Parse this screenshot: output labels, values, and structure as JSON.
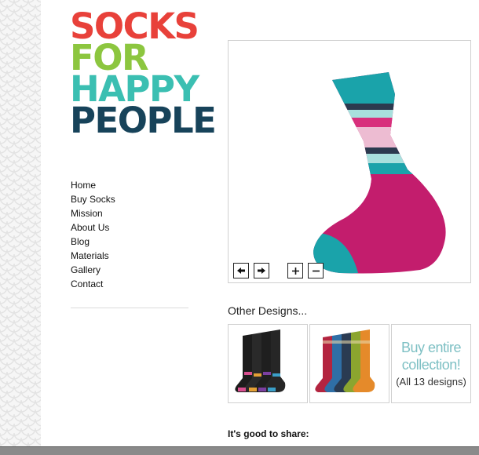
{
  "logo": {
    "line1": "SOCKS",
    "line2": "FOR",
    "line3": "HAPPY",
    "line4": "PEOPLE",
    "colors": [
      "#e8413a",
      "#8cc63f",
      "#3bbfb2",
      "#17435a"
    ]
  },
  "nav": {
    "items": [
      "Home",
      "Buy Socks",
      "Mission",
      "About Us",
      "Blog",
      "Materials",
      "Gallery",
      "Contact"
    ]
  },
  "gallery_controls": {
    "prev_icon": "arrow-left-icon",
    "next_icon": "arrow-right-icon",
    "zoom_in_icon": "plus-icon",
    "zoom_out_icon": "minus-icon"
  },
  "other_designs": {
    "title": "Other Designs...",
    "buy_collection_line1": "Buy entire",
    "buy_collection_line2": "collection!",
    "buy_collection_line3": "(All 13 designs)"
  },
  "share": {
    "label": "It's good to share:"
  }
}
